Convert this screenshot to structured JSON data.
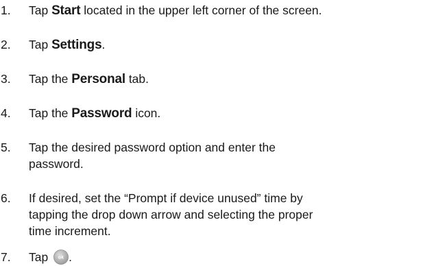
{
  "steps": [
    {
      "number": "1.",
      "pre": "Tap ",
      "bold": "Start",
      "post": " located in the upper left corner of the screen."
    },
    {
      "number": "2.",
      "pre": "Tap ",
      "bold": "Settings",
      "post": "."
    },
    {
      "number": "3.",
      "pre": "Tap the ",
      "bold": "Personal",
      "post": " tab."
    },
    {
      "number": "4.",
      "pre": "Tap the ",
      "bold": "Password",
      "post": " icon."
    },
    {
      "number": "5.",
      "lines": [
        "Tap the desired password option and enter the",
        "password."
      ]
    },
    {
      "number": "6.",
      "lines": [
        "If desired, set the “Prompt if device unused” time by",
        "tapping the drop down arrow and selecting the proper",
        "time increment."
      ]
    },
    {
      "number": "7.",
      "pre": "Tap ",
      "icon_label": "ok",
      "icon_name": "ok-button-icon",
      "post": "."
    }
  ],
  "colors": {
    "text": "#1a1a1a",
    "ok_button_fill": "#b7b7b7",
    "ok_button_label": "#ffffff"
  }
}
